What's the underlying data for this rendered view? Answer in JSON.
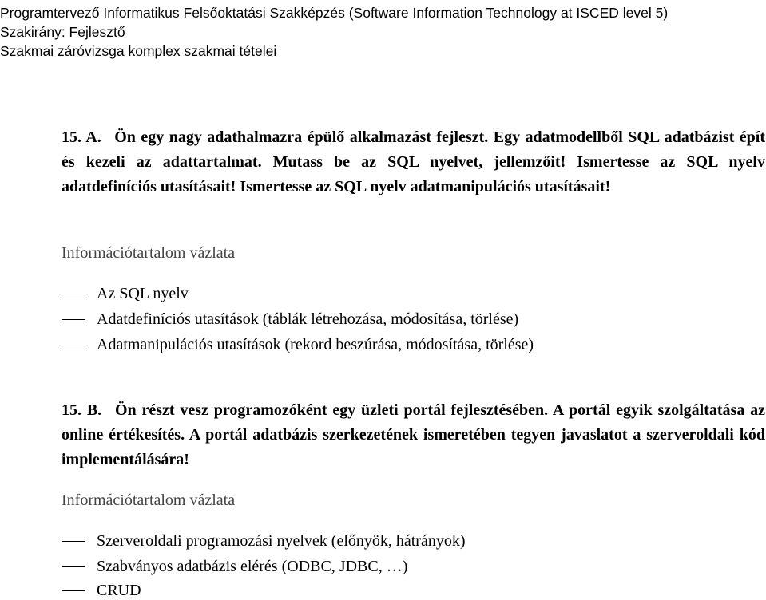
{
  "header": {
    "line1": "Programtervező Informatikus Felsőoktatási Szakképzés (Software Information Technology at ISCED level 5)",
    "line2": "Szakirány: Fejlesztő",
    "line3": "Szakmai záróvizsga komplex szakmai tételei"
  },
  "sections": [
    {
      "number": "15. A.",
      "question": "Ön egy nagy adathalmazra épülő alkalmazást fejleszt. Egy adatmodellből SQL adatbázist épít és kezeli az adattartalmat. Mutass be az SQL nyelvet, jellemzőit! Ismertesse az SQL nyelv adatdefiníciós utasításait! Ismertesse az SQL nyelv adatmanipulációs utasításait!",
      "subtitle": "Információtartalom vázlata",
      "items": [
        "Az SQL nyelv",
        "Adatdefiníciós utasítások (táblák létrehozása, módosítása, törlése)",
        "Adatmanipulációs utasítások (rekord beszúrása, módosítása, törlése)"
      ]
    },
    {
      "number": "15. B.",
      "question": "Ön részt vesz programozóként egy üzleti portál fejlesztésében. A portál egyik szolgáltatása az online értékesítés. A portál adatbázis szerkezetének ismeretében tegyen javaslatot a szerveroldali kód implementálására!",
      "subtitle": "Információtartalom vázlata",
      "items": [
        "Szerveroldali programozási nyelvek (előnyök, hátrányok)",
        "Szabványos adatbázis elérés (ODBC, JDBC, …)",
        "CRUD"
      ]
    }
  ]
}
